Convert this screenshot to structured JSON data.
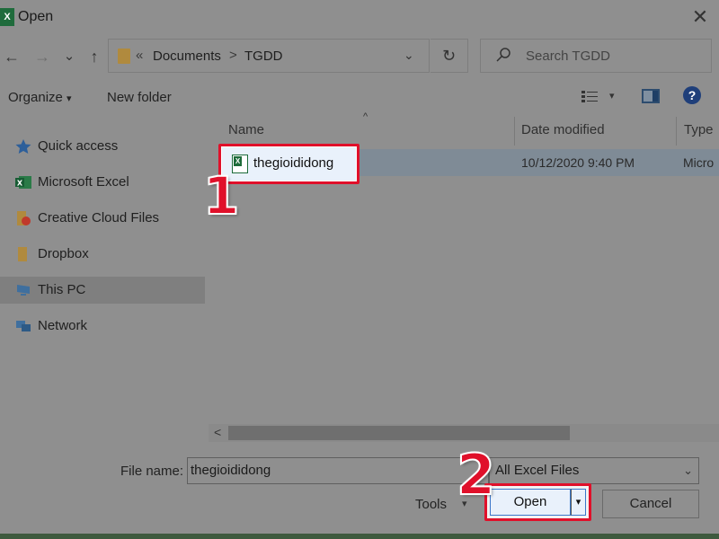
{
  "window": {
    "title": "Open",
    "app_icon": "excel-icon",
    "close_glyph": "✕"
  },
  "nav": {
    "back_glyph": "←",
    "forward_glyph": "→",
    "recent_glyph": "⌄",
    "up_glyph": "↑",
    "breadcrumb_prefix": "«",
    "breadcrumb": [
      "Documents",
      "TGDD"
    ],
    "breadcrumb_separator": ">",
    "dropdown_glyph": "⌄",
    "refresh_glyph": "↻",
    "search_placeholder": "Search TGDD"
  },
  "toolbar": {
    "organize_label": "Organize",
    "organize_caret": "▾",
    "new_folder_label": "New folder",
    "view_caret": "▾",
    "help_glyph": "?"
  },
  "sidebar": {
    "items": [
      {
        "label": "Quick access",
        "icon": "star-icon",
        "selected": false
      },
      {
        "label": "Microsoft Excel",
        "icon": "excel-icon",
        "selected": false
      },
      {
        "label": "Creative Cloud Files",
        "icon": "creative-cloud-folder-icon",
        "selected": false
      },
      {
        "label": "Dropbox",
        "icon": "folder-icon",
        "selected": false
      },
      {
        "label": "This PC",
        "icon": "computer-icon",
        "selected": true
      },
      {
        "label": "Network",
        "icon": "network-icon",
        "selected": false
      }
    ]
  },
  "file_list": {
    "columns": [
      "Name",
      "Date modified",
      "Type"
    ],
    "sort_caret": "^",
    "files": [
      {
        "name": "thegioididong",
        "date_modified": "10/12/2020 9:40 PM",
        "type": "Micro",
        "icon": "excel-file-icon",
        "selected": true
      }
    ],
    "scroll_left_glyph": "<"
  },
  "footer": {
    "file_name_label": "File name:",
    "file_name_value": "thegioididong",
    "file_type_filter": "All Excel Files",
    "filter_caret": "⌄",
    "tools_label": "Tools",
    "tools_caret": "▾",
    "open_label": "Open",
    "open_caret": "▾",
    "cancel_label": "Cancel"
  },
  "annotations": {
    "step1": "1",
    "step2": "2",
    "accent_color": "#e0102a"
  }
}
